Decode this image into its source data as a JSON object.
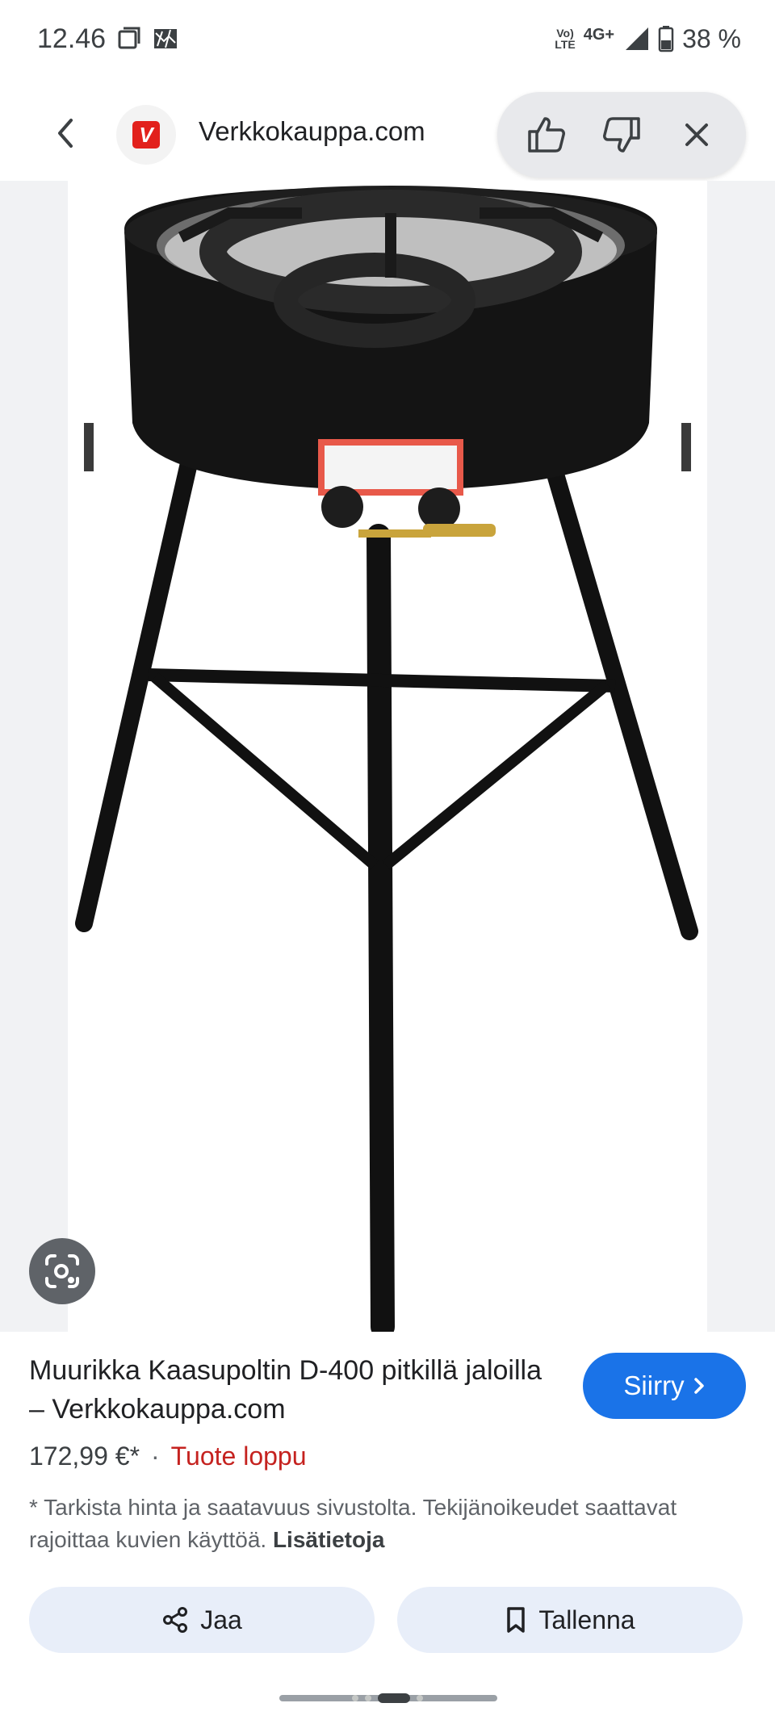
{
  "status_bar": {
    "time": "12.46",
    "network_top": "Vo)",
    "network_bottom": "LTE",
    "network_type": "4G+",
    "battery": "38 %"
  },
  "header": {
    "site_name": "Verkkokauppa.com",
    "logo_letter": "V"
  },
  "result": {
    "title": "Muurikka Kaasupoltin D-400 pitkillä jaloilla – Verkkokauppa.com",
    "visit_label": "Siirry",
    "price": "172,99 €*",
    "separator": "·",
    "stock_status": "Tuote loppu",
    "disclaimer": "* Tarkista hinta ja saatavuus sivustolta. Tekijänoikeudet saattavat rajoittaa kuvien käyttöä.",
    "more_info": "Lisätietoja"
  },
  "actions": {
    "share_label": "Jaa",
    "save_label": "Tallenna"
  },
  "colors": {
    "accent": "#1a73e8",
    "out_of_stock": "#c5221f",
    "brand_red": "#e2211c",
    "button_bg": "#e8eef9"
  },
  "icons": [
    "back-arrow-icon",
    "thumbs-up-icon",
    "thumbs-down-icon",
    "close-icon",
    "lens-icon",
    "chevron-right-icon",
    "share-icon",
    "bookmark-icon"
  ]
}
